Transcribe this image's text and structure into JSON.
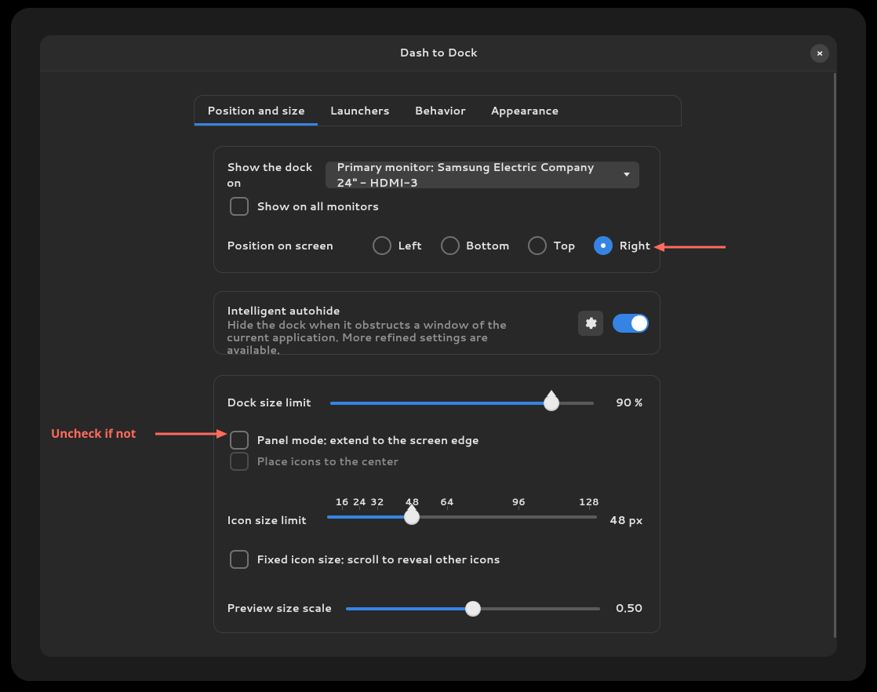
{
  "dialog": {
    "title": "Dash to Dock",
    "close_icon": "×"
  },
  "tabs": [
    {
      "id": "position-size",
      "label": "Position and size",
      "active": true
    },
    {
      "id": "launchers",
      "label": "Launchers",
      "active": false
    },
    {
      "id": "behavior",
      "label": "Behavior",
      "active": false
    },
    {
      "id": "appearance",
      "label": "Appearance",
      "active": false
    }
  ],
  "section_position": {
    "show_dock_on_label": "Show the dock on",
    "monitor_select_value": "Primary monitor: Samsung Electric Company 24\" - HDMI-3",
    "show_on_all_label": "Show on all monitors",
    "show_on_all_checked": false,
    "position_label": "Position on screen",
    "options": [
      {
        "id": "left",
        "label": "Left",
        "checked": false
      },
      {
        "id": "bottom",
        "label": "Bottom",
        "checked": false
      },
      {
        "id": "top",
        "label": "Top",
        "checked": false
      },
      {
        "id": "right",
        "label": "Right",
        "checked": true
      }
    ]
  },
  "section_autohide": {
    "title": "Intelligent autohide",
    "description_line1": "Hide the dock when it obstructs a window of the",
    "description_line2": "current application. More refined settings are available.",
    "gear_icon_name": "gear-icon",
    "enabled": true
  },
  "section_sizes": {
    "dock_size_limit_label": "Dock size limit",
    "dock_size_limit_value": 90,
    "dock_size_limit_display": "90 %",
    "panel_mode_label": "Panel mode: extend to the screen edge",
    "panel_mode_checked": false,
    "place_icons_center_label": "Place icons to the center",
    "place_icons_center_checked": false,
    "icon_size_limit_label": "Icon size limit",
    "icon_size_limit_value": 48,
    "icon_size_limit_display": "48 px",
    "icon_ticks": [
      16,
      24,
      32,
      48,
      64,
      96,
      128
    ],
    "fixed_icon_size_label": "Fixed icon size: scroll to reveal other icons",
    "fixed_icon_size_checked": false,
    "preview_size_scale_label": "Preview size scale",
    "preview_size_scale_value": 0.5,
    "preview_size_scale_display": "0.50"
  },
  "annotations": {
    "right_arrow": "arrow pointing to Right radio",
    "uncheck_label": "Uncheck if not"
  }
}
